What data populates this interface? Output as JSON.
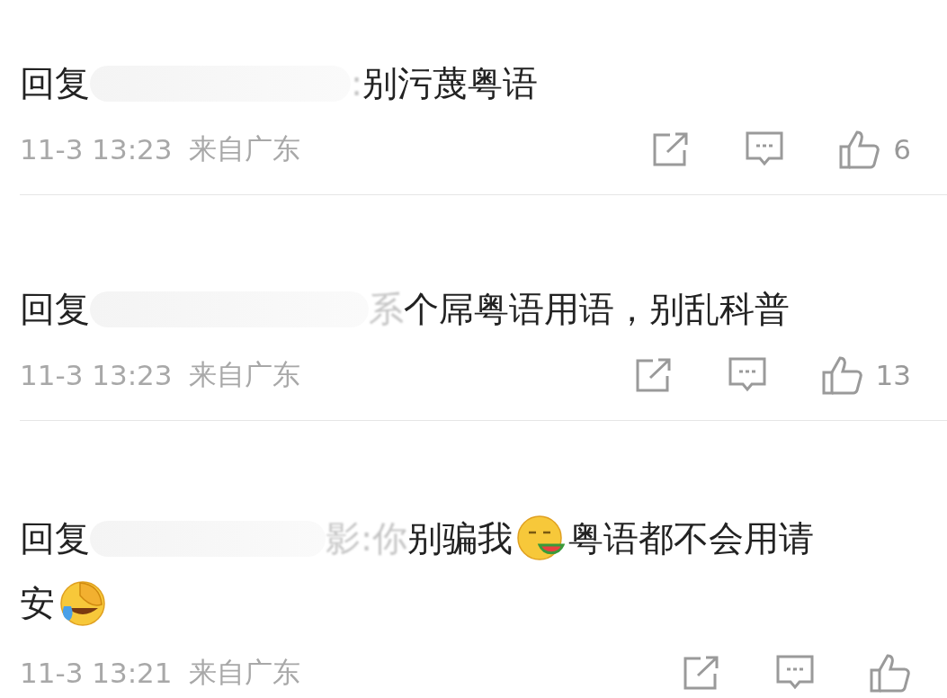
{
  "comments": [
    {
      "reply_label": "回复",
      "faded": ":",
      "lines": [
        [
          {
            "kind": "text",
            "text": "别污蔑粤语"
          }
        ]
      ],
      "time": "11-3 13:23",
      "location": "来自广东",
      "likes": "6"
    },
    {
      "reply_label": "回复",
      "faded": "系",
      "lines": [
        [
          {
            "kind": "text",
            "text": "个屌粤语用语，别乱科普"
          }
        ]
      ],
      "time": "11-3 13:23",
      "location": "来自广东",
      "likes": "13"
    },
    {
      "reply_label": "回复",
      "faded": "影:你",
      "lines": [
        [
          {
            "kind": "text",
            "text": "别骗我"
          },
          {
            "kind": "emoji"
          },
          {
            "kind": "text",
            "text": "粤语都不会用请"
          }
        ],
        [
          {
            "kind": "text",
            "text": "安"
          },
          {
            "kind": "emoji"
          }
        ]
      ],
      "time": "11-3 13:21",
      "location": "来自广东"
    }
  ]
}
